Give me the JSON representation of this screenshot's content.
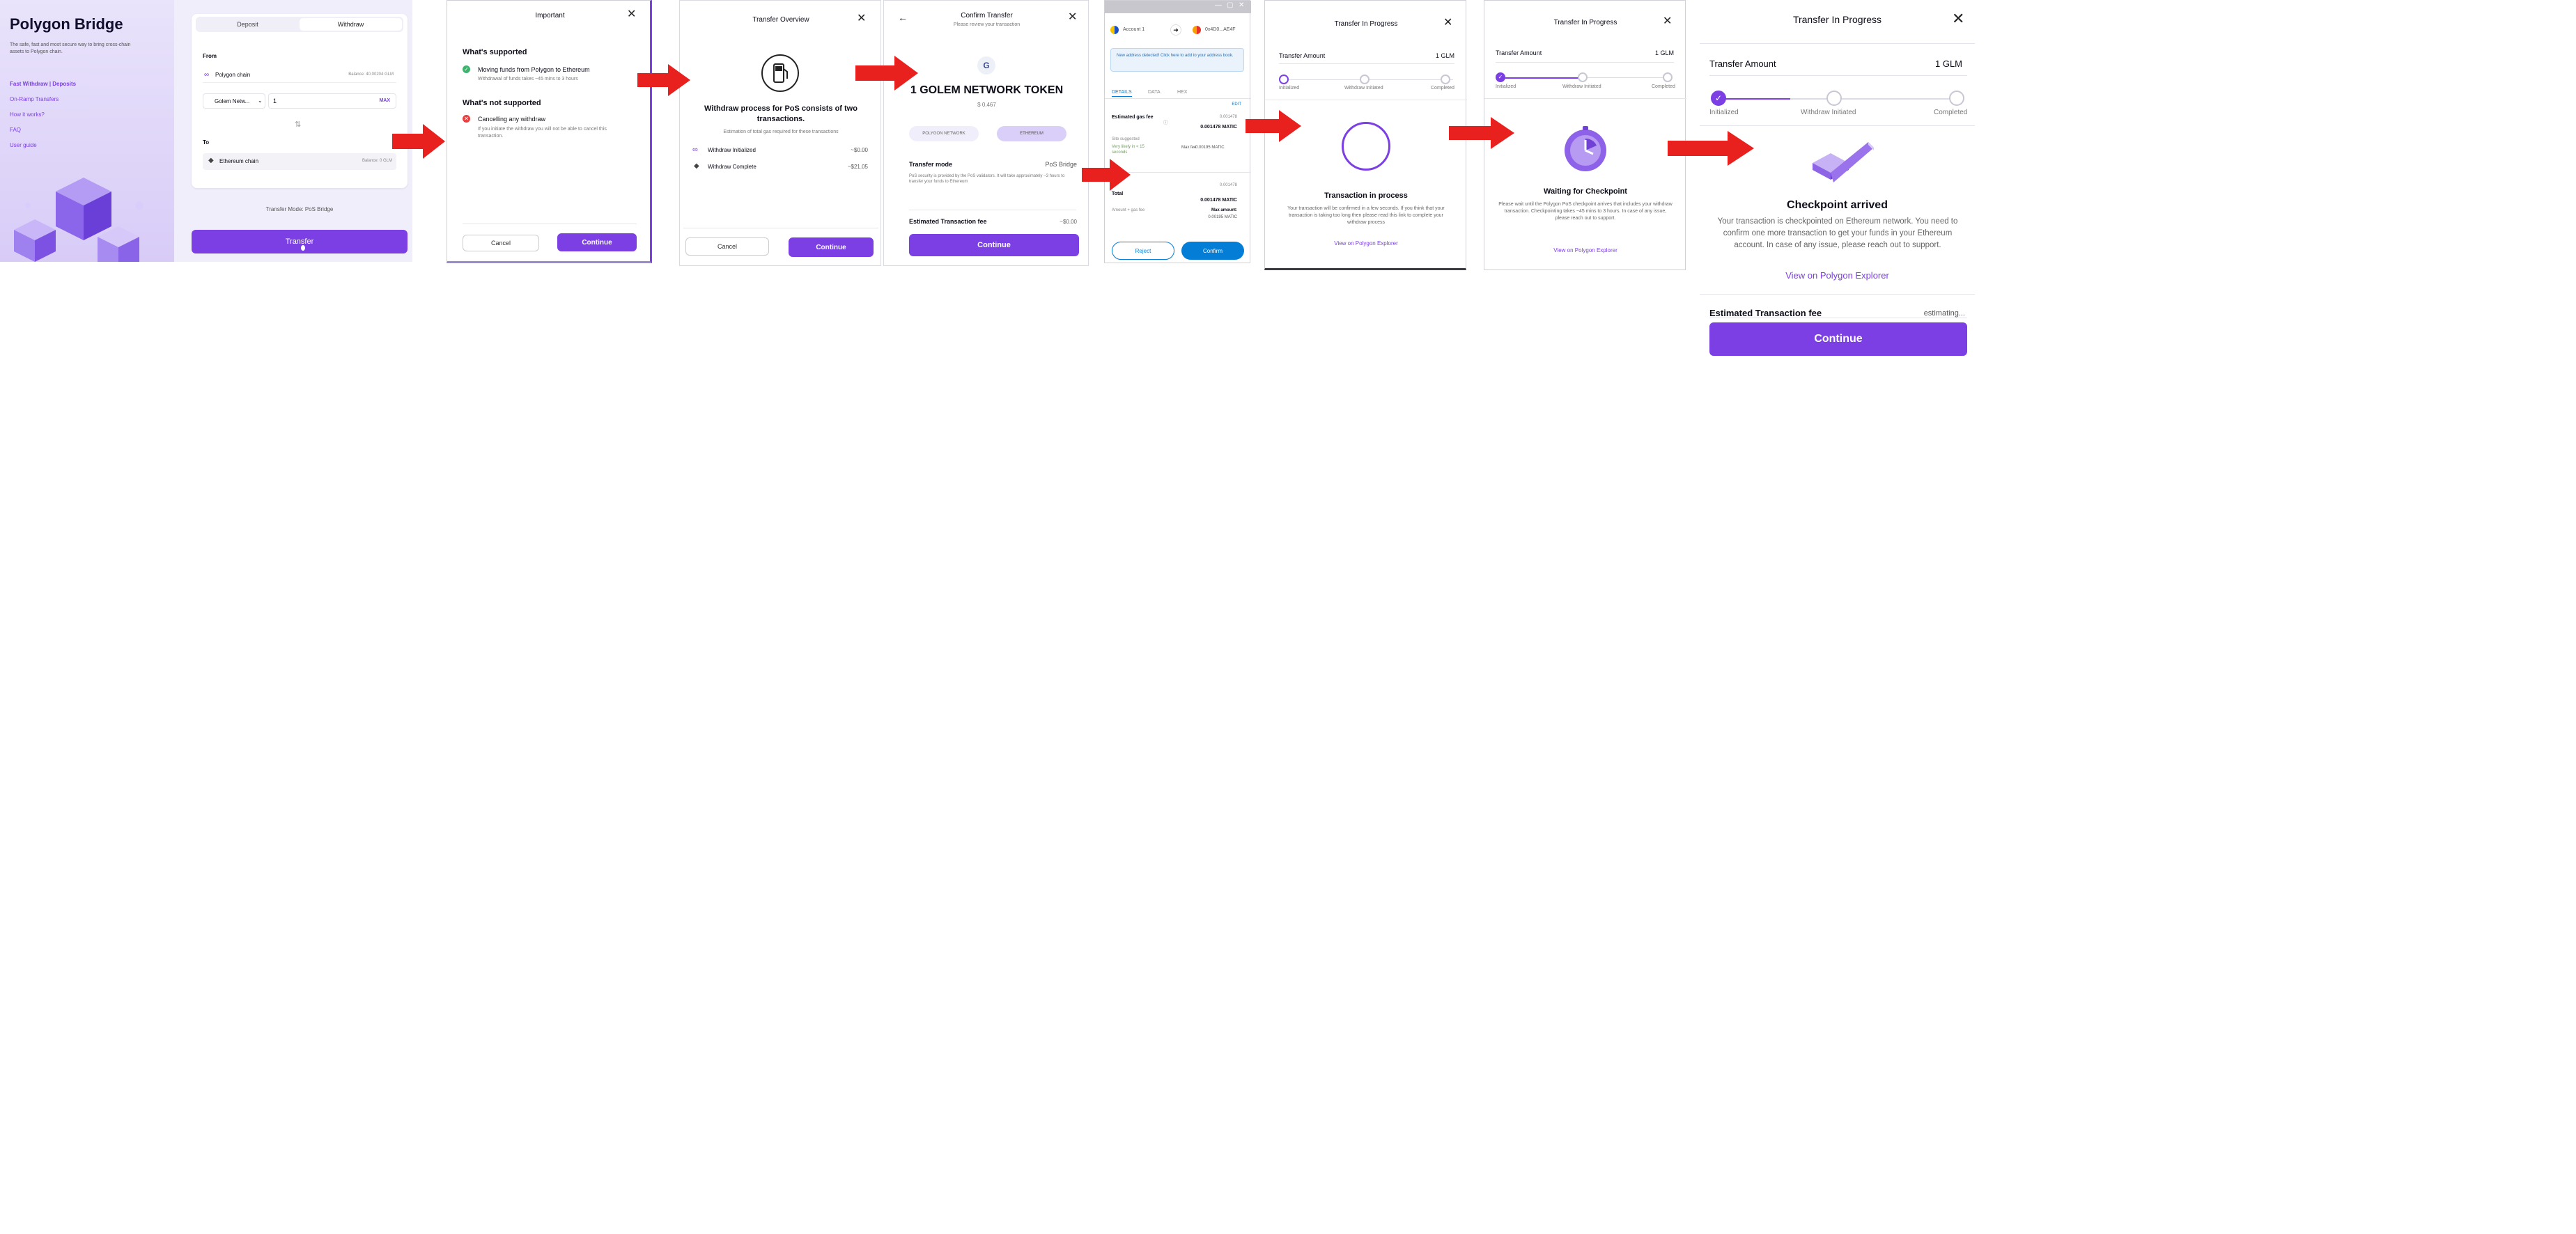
{
  "p1": {
    "title": "Polygon Bridge",
    "subtitle": "The safe, fast and most secure way to bring cross-chain assets to Polygon chain.",
    "nav": [
      "Fast Withdraw | Deposits",
      "On-Ramp Transfers",
      "How it works?",
      "FAQ",
      "User guide"
    ],
    "tabs": {
      "deposit": "Deposit",
      "withdraw": "Withdraw"
    },
    "from_label": "From",
    "from_chain": "Polygon chain",
    "from_balance": "Balance: 40.00204 GLM",
    "token": "Golem Netw...",
    "amount": "1",
    "max": "MAX",
    "to_label": "To",
    "to_chain": "Ethereum chain",
    "to_balance": "Balance: 0 GLM",
    "mode": "Transfer Mode: PoS Bridge",
    "transfer_btn": "Transfer"
  },
  "p2": {
    "title": "Important",
    "supported_h": "What's supported",
    "supported_t": "Moving funds from Polygon to Ethereum",
    "supported_s": "Withdrawal of funds takes ~45 mins to 3 hours",
    "not_h": "What's not supported",
    "not_t": "Cancelling any withdraw",
    "not_s": "If you initiate the withdraw you will not be able to cancel this transaction.",
    "cancel": "Cancel",
    "continue": "Continue"
  },
  "p3": {
    "title": "Transfer Overview",
    "heading": "Withdraw process for PoS consists of two transactions.",
    "sub": "Estimation of total gas required for these transactions",
    "rows": [
      {
        "label": "Withdraw Initialized",
        "value": "~$0.00"
      },
      {
        "label": "Withdraw Complete",
        "value": "~$21.05"
      }
    ],
    "cancel": "Cancel",
    "continue": "Continue"
  },
  "p4": {
    "title": "Confirm Transfer",
    "subtitle": "Please review your transaction",
    "token_letter": "G",
    "amount": "1 GOLEM NETWORK TOKEN",
    "usd": "$ 0.467",
    "from_pill": "POLYGON NETWORK",
    "to_pill": "ETHEREUM",
    "mode_label": "Transfer mode",
    "mode_value": "PoS Bridge",
    "note": "PoS security is provided by the PoS validators. It will take approximately ~3 hours to transfer your funds to Ethereum",
    "fee_label": "Estimated Transaction fee",
    "fee_value": "~$0.00",
    "continue": "Continue"
  },
  "p5": {
    "account": "Account 1",
    "contract": "0x4D0...AE4F",
    "banner": "New address detected! Click here to add to your address book.",
    "tabs": [
      "DETAILS",
      "DATA",
      "HEX"
    ],
    "edit": "EDIT",
    "gas_label": "Estimated gas fee",
    "gas_top": "0.001478",
    "gas_value": "0.001478 MATIC",
    "gas_sub": "Site suggested",
    "gas_likely": "Very likely in < 15 seconds",
    "max_fee_label": "Max fee:",
    "max_fee_value": "0.00195 MATIC",
    "total_label": "Total",
    "total_top": "0.001478",
    "total_value": "0.001478 MATIC",
    "amount_gas": "Amount + gas fee",
    "max_amount_label": "Max amount:",
    "max_amount_value": "0.00195 MATIC",
    "reject": "Reject",
    "confirm": "Confirm"
  },
  "p6": {
    "title": "Transfer In Progress",
    "amount_label": "Transfer Amount",
    "amount_value": "1 GLM",
    "steps": [
      "Initialized",
      "Withdraw Initiated",
      "Completed"
    ],
    "status": "Transaction in process",
    "desc": "Your transaction will be confirmed in a few seconds. If you think that your transaction is taking too long then please read this link to complete your withdraw process",
    "link": "View on Polygon Explorer"
  },
  "p7": {
    "title": "Transfer In Progress",
    "amount_label": "Transfer Amount",
    "amount_value": "1 GLM",
    "steps": [
      "Initialized",
      "Withdraw Initiated",
      "Completed"
    ],
    "status": "Waiting for Checkpoint",
    "desc": "Please wait until the Polygon PoS checkpoint arrives that includes your withdraw transaction. Checkpointing takes ~45 mins to 3 hours. In case of any issue, please reach out to support.",
    "link": "View on Polygon Explorer"
  },
  "p8": {
    "title": "Transfer In Progress",
    "amount_label": "Transfer Amount",
    "amount_value": "1 GLM",
    "steps": [
      "Initialized",
      "Withdraw Initiated",
      "Completed"
    ],
    "status": "Checkpoint arrived",
    "desc": "Your transaction is checkpointed on Ethereum network. You need to confirm one more transaction to get your funds in your Ethereum account. In case of any issue, please reach out to support.",
    "link": "View on Polygon Explorer",
    "fee_label": "Estimated Transaction fee",
    "fee_value": "estimating...",
    "continue": "Continue"
  },
  "colors": {
    "brand": "#7b3fe4",
    "arrow": "#e8201e",
    "metamask": "#037dd6"
  }
}
